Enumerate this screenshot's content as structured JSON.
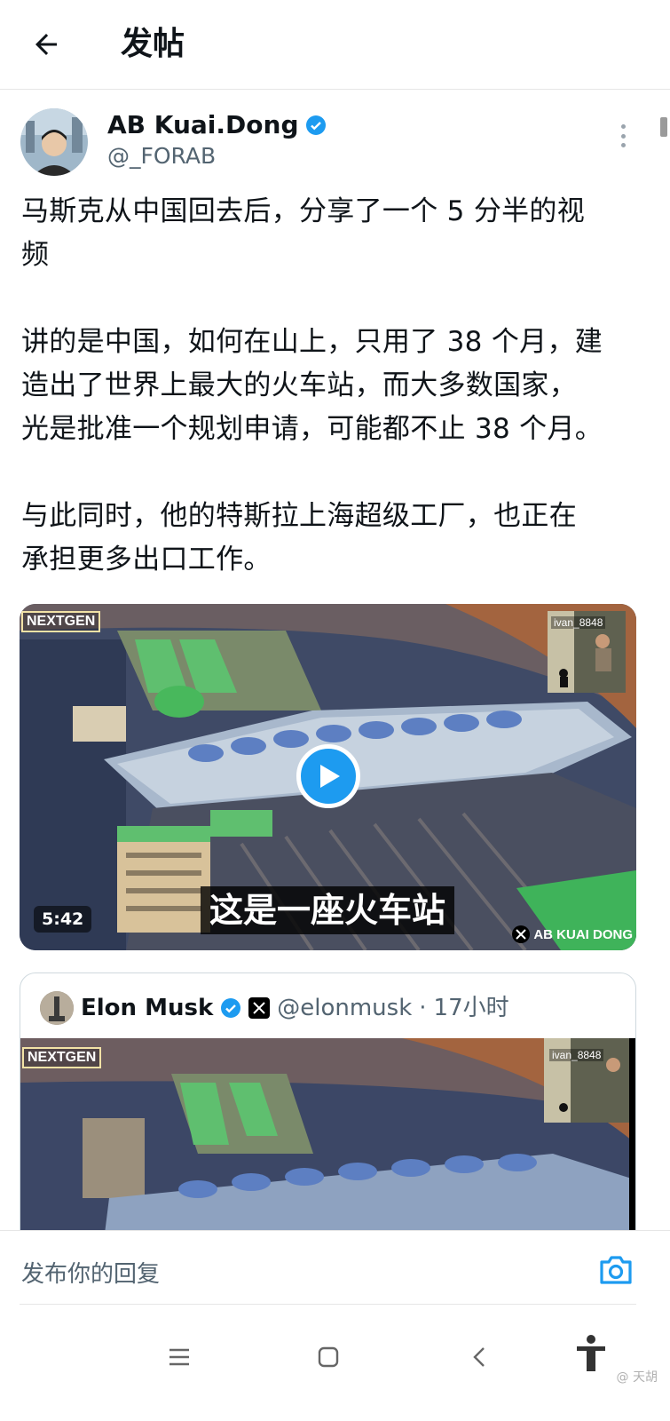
{
  "header": {
    "title": "发帖",
    "back_icon": "arrow-left-icon"
  },
  "post": {
    "author_name": "AB Kuai.Dong",
    "author_handle": "@_FORAB",
    "verified_color": "#1d9bf0",
    "text": "马斯克从中国回去后，分享了一个 5 分半的视\n频\n\n讲的是中国，如何在山上，只用了 38 个月，建\n造出了世界上最大的火车站，而大多数国家，\n光是批准一个规划申请，可能都不止 38 个月。\n\n与此同时，他的特斯拉上海超级工厂，也正在\n承担更多出口工作。",
    "video": {
      "duration": "5:42",
      "subtitle": "这是一座火车站",
      "brand_tag": "NEXTGEN",
      "inset_tag": "ivan_8848",
      "watermark": "AB KUAI DONG"
    }
  },
  "quote": {
    "author_name": "Elon Musk",
    "author_handle": "@elonmusk",
    "separator": "·",
    "time": "17小时",
    "brand_tag": "NEXTGEN",
    "inset_tag": "ivan_8848"
  },
  "reply": {
    "placeholder": "发布你的回复",
    "camera_icon": "camera-icon",
    "accent": "#1d9bf0"
  },
  "nav": {
    "buttons": [
      "menu-icon",
      "home-square-icon",
      "back-chevron-icon",
      "accessibility-icon"
    ]
  },
  "source_mark": "@ 天胡"
}
